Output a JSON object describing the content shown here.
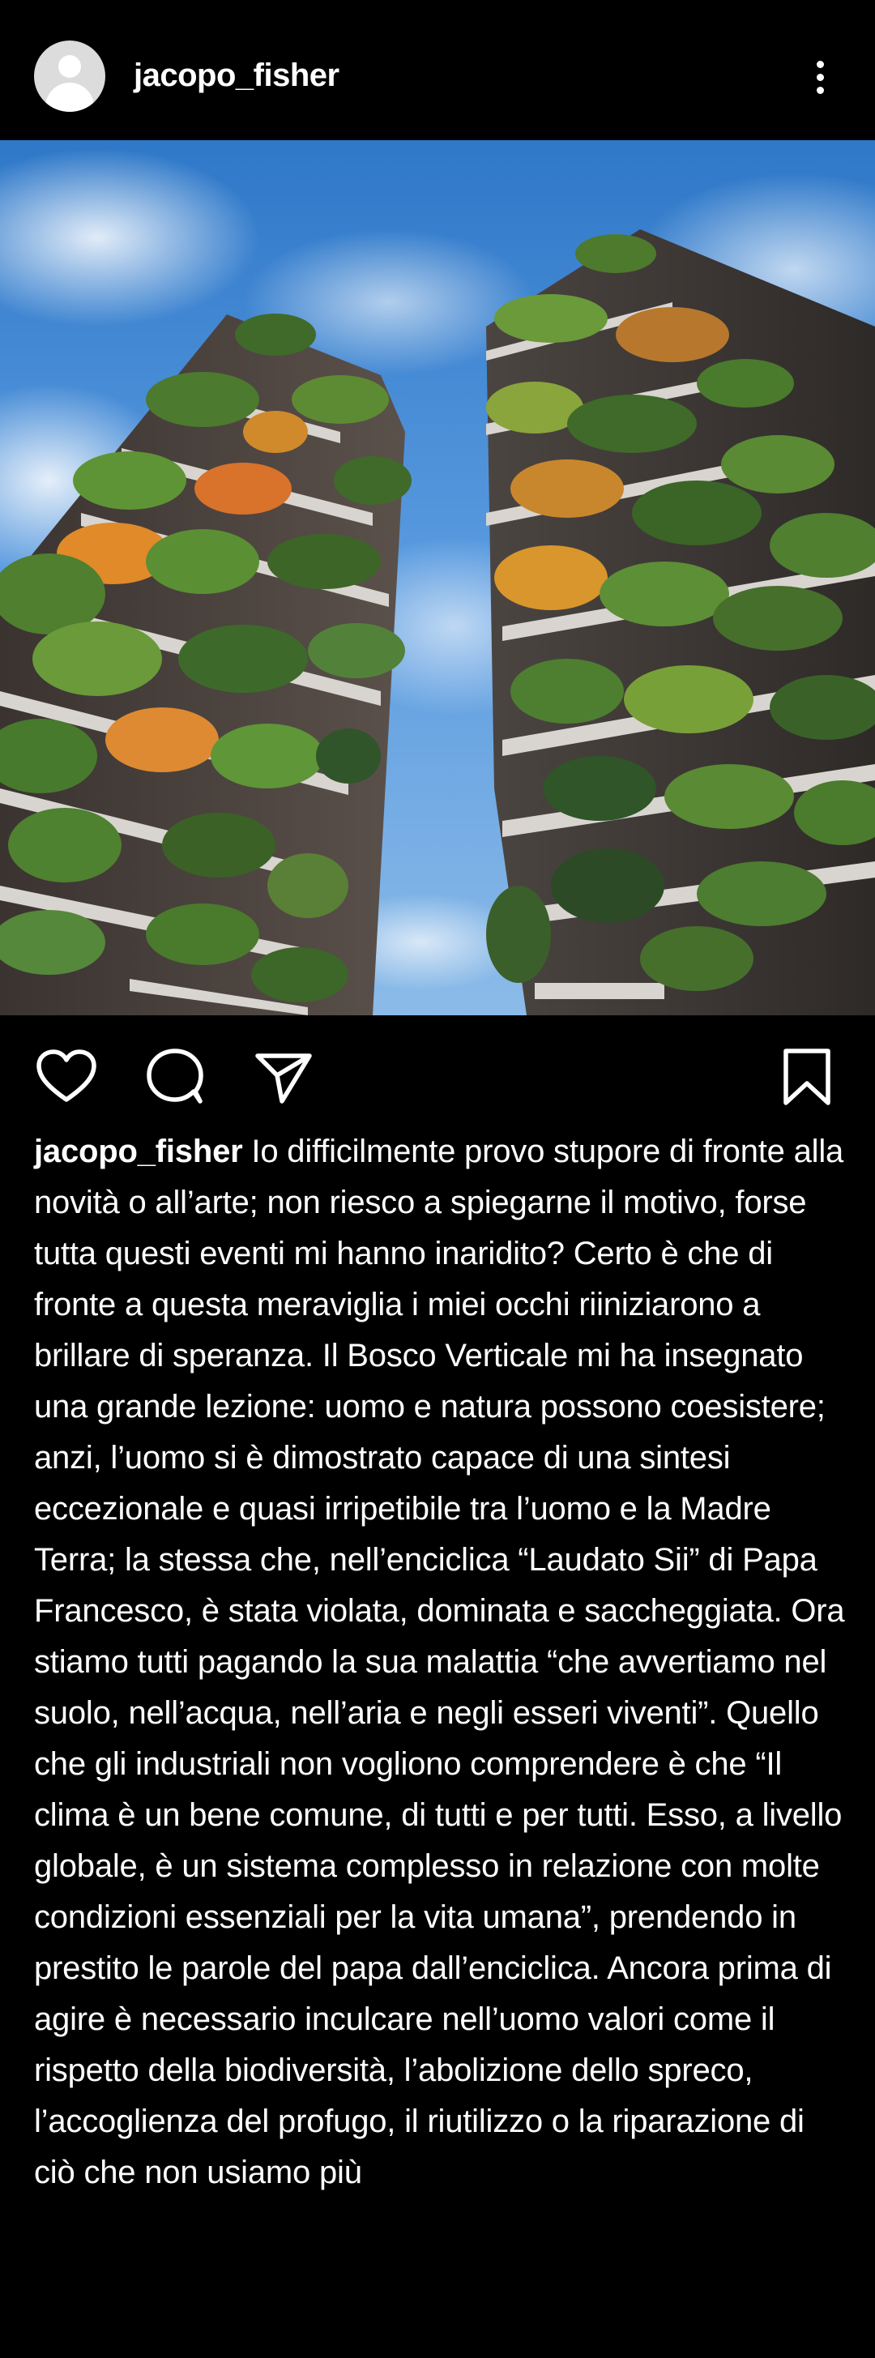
{
  "post": {
    "username": "jacopo_fisher",
    "photo_alt": "Bosco Verticale towers",
    "caption_user": "jacopo_fisher",
    "caption_text": "Io difficilmente provo stupore di fronte alla novità o all’arte; non riesco a spiegarne il motivo, forse tutta questi eventi mi hanno inaridito? Certo è che di fronte a questa meraviglia i miei occhi riiniziarono a brillare di speranza. Il Bosco Verticale mi ha insegnato una grande lezione: uomo e natura possono coesistere; anzi, l’uomo si è dimostrato capace di una sintesi eccezionale e quasi irripetibile tra l’uomo e la Madre Terra; la stessa che, nell’enciclica “Laudato Sii” di Papa Francesco, è stata violata, dominata e saccheggiata. Ora stiamo tutti pagando la sua malattia “che avvertiamo nel suolo, nell’acqua, nell’aria e negli esseri viventi”. Quello che gli industriali non vogliono comprendere è che “Il clima è un bene comune, di tutti e per tutti. Esso, a livello globale, è un sistema complesso in relazione con molte condizioni essenziali per la vita umana”, prendendo in prestito le parole del papa dall’enciclica. Ancora prima di agire è necessario inculcare nell’uomo valori come il rispetto della biodiversità, l’abolizione dello spreco, l’accoglienza del profugo, il riutilizzo o la riparazione di ciò che non usiamo più"
  },
  "icons": {
    "avatar": "default-avatar-icon",
    "more": "more-vertical-icon",
    "like": "heart-icon",
    "comment": "comment-bubble-icon",
    "share": "paper-plane-icon",
    "save": "bookmark-icon"
  },
  "colors": {
    "background": "#000000",
    "text": "#ffffff",
    "sky": "#4f92d6"
  }
}
